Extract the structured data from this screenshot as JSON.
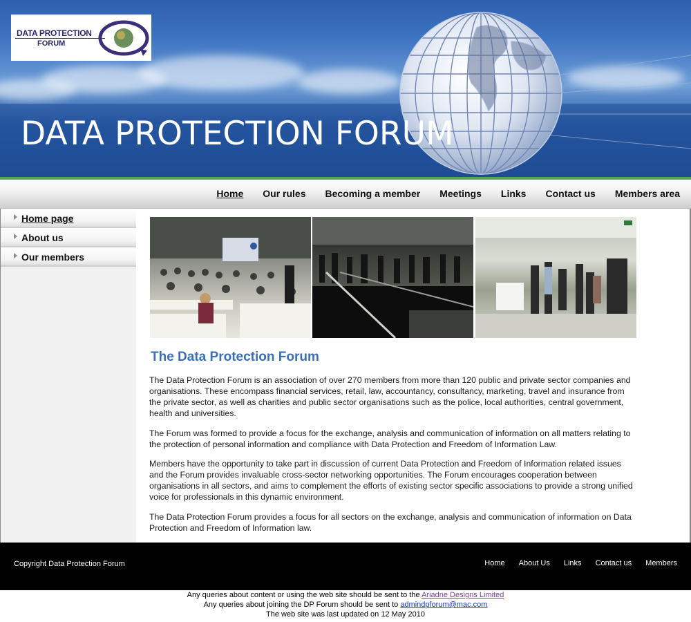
{
  "banner": {
    "title": "DATA PROTECTION FORUM",
    "logo_line1": "DATA PROTECTION",
    "logo_line2": "FORUM"
  },
  "nav": {
    "items": [
      "Home",
      "Our rules",
      "Becoming a member",
      "Meetings",
      "Links",
      "Contact us",
      "Members area"
    ],
    "active": "Home"
  },
  "sidebar": {
    "items": [
      "Home page",
      "About us",
      "Our members"
    ],
    "active": "Home page"
  },
  "content": {
    "heading": "The Data Protection Forum",
    "paragraphs": [
      "The Data Protection Forum is an association of over 270 members from more than 120 public and private sector companies and organisations. These encompass financial services, retail, law, accountancy, consultancy, marketing, travel and insurance from the private sector, as well as charities and public sector organisations such as the police, local authorities, central government, health and universities.",
      "The Forum was formed to provide a focus for the exchange, analysis and communication of information on all matters relating to the protection of personal information and compliance with Data Protection and Freedom of Information Law.",
      "Members have the opportunity to take part in discussion of current Data Protection and Freedom of Information related issues and the Forum provides invaluable cross-sector networking opportunities. The Forum encourages cooperation between organisations in all sectors, and aims to complement the efforts of existing sector specific associations to provide a strong unified voice for professionals in this dynamic environment.",
      "The Data Protection Forum provides a focus for all sectors on the exchange, analysis and communication of information on Data Protection and Freedom of Information law."
    ]
  },
  "footer": {
    "copyright": "Copyright Data Protection Forum",
    "links": [
      "Home",
      "About Us",
      "Links",
      "Contact us",
      "Members"
    ]
  },
  "bottom": {
    "line1_text": "Any queries about content or using the web site should be sent to the ",
    "line1_link": "Ariadne Designs Limited",
    "line2_text": "Any queries about joining the DP Forum should be sent to ",
    "line2_link": "admindpforum@mac.com",
    "line3_text": "The web site was last updated on 12 May 2010"
  },
  "colors": {
    "heading": "#3a6fb6",
    "accent_green": "#5aa84a",
    "footer_bg": "#000000",
    "visited_link": "#7a3f9e",
    "link": "#1a33c7"
  }
}
